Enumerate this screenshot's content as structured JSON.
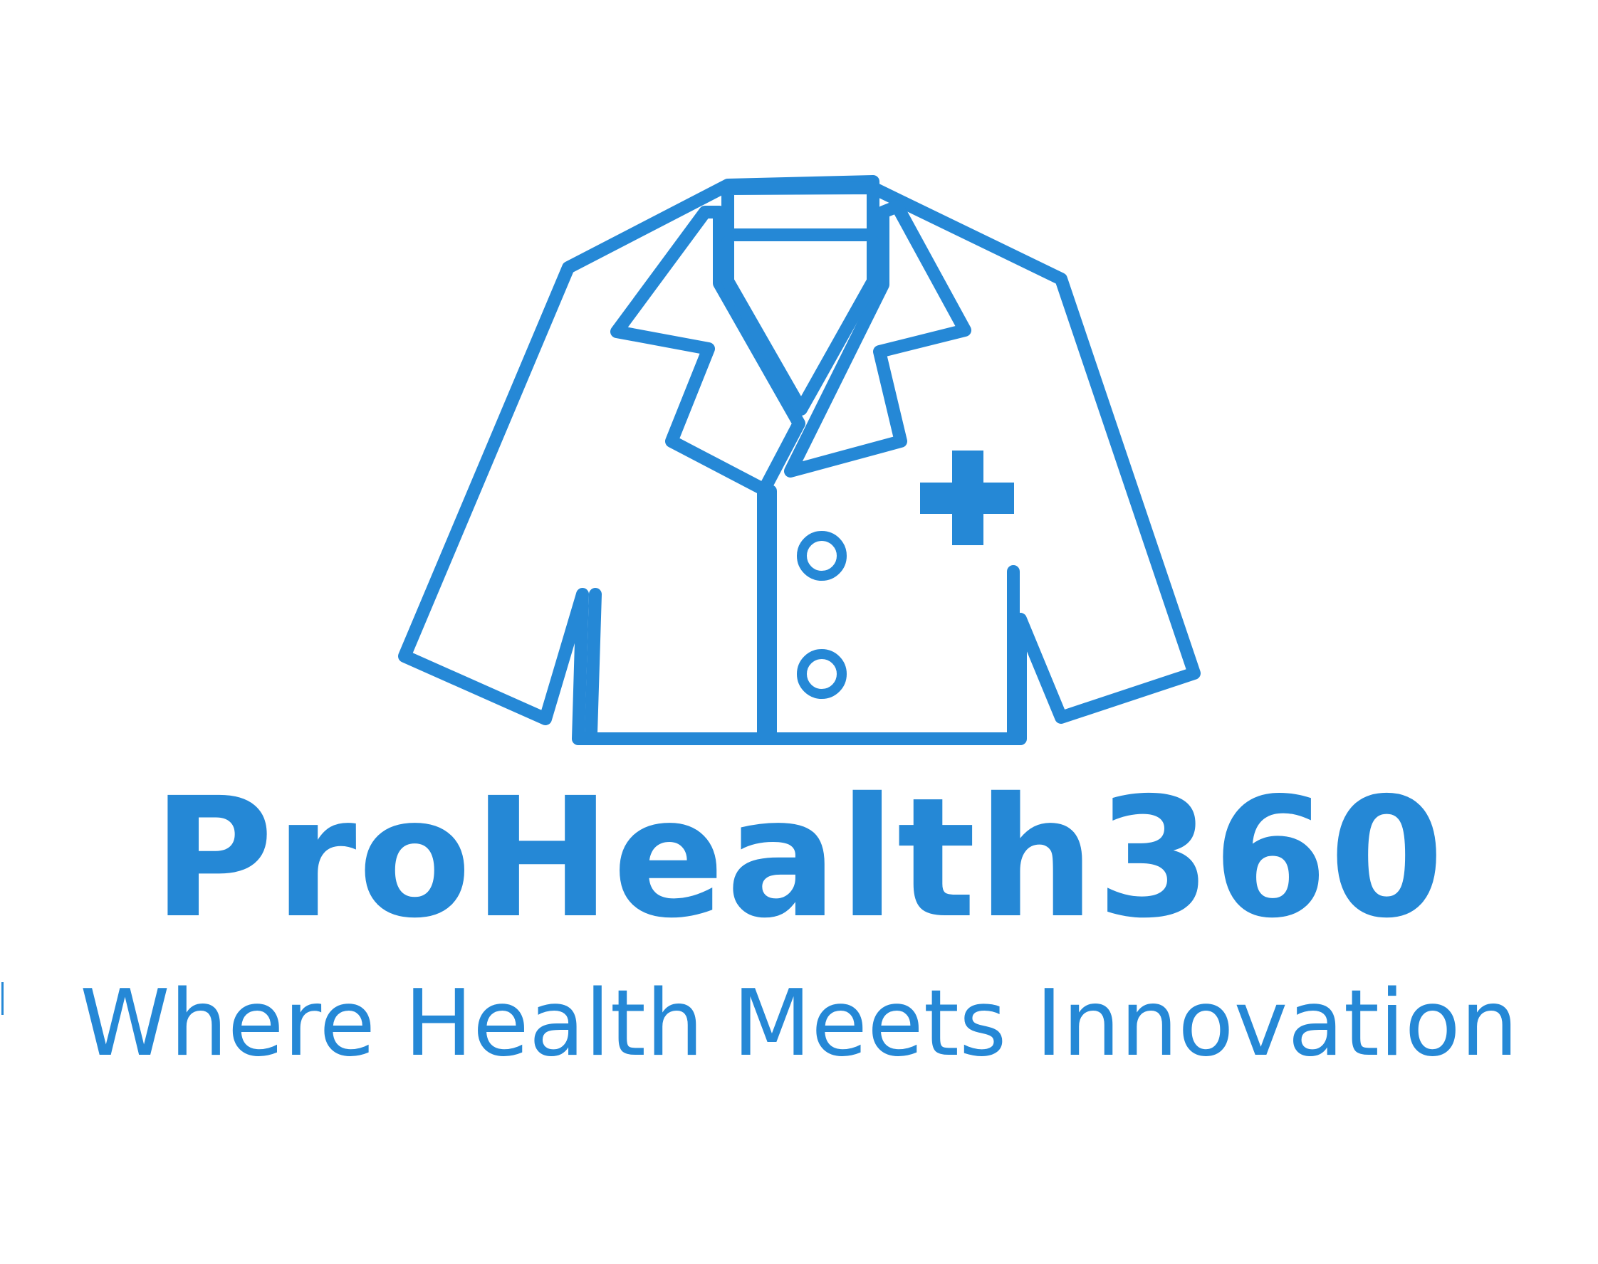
{
  "brand": {
    "name": "ProHealth360",
    "tagline": "Where Health Meets Innovation"
  },
  "logo": {
    "icon": "lab-coat-icon",
    "badge_icon": "medical-cross-icon",
    "button_icon": "button-icon"
  },
  "colors": {
    "primary": "#2588d6",
    "background": "#ffffff"
  }
}
